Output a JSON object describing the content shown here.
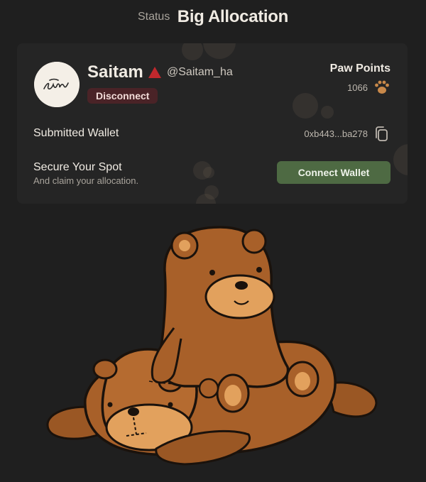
{
  "header": {
    "status_label": "Status",
    "title": "Big Allocation"
  },
  "profile": {
    "avatar_text": "Saitam",
    "username": "Saitam",
    "handle": "@Saitam_ha",
    "warning_icon": "triangle-warning-icon",
    "disconnect_label": "Disconnect"
  },
  "paw_points": {
    "label": "Paw Points",
    "value": "1066",
    "icon": "paw-icon"
  },
  "wallet": {
    "label": "Submitted Wallet",
    "address": "0xb443...ba278",
    "copy_icon": "copy-icon"
  },
  "secure": {
    "title": "Secure Your Spot",
    "subtitle": "And claim your allocation.",
    "button_label": "Connect Wallet"
  },
  "illustration": {
    "name": "two-bears-illustration"
  },
  "colors": {
    "background": "#1f1f1f",
    "card": "#252525",
    "disconnect_bg": "#4a2327",
    "connect_bg": "#4e6a43",
    "warning": "#c0282d",
    "paw": "#c9894a"
  }
}
